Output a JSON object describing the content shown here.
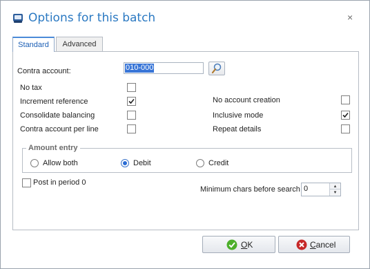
{
  "window": {
    "title": "Options for this batch",
    "close_glyph": "×",
    "icon": "batch-app-icon"
  },
  "tabs": [
    {
      "label": "Standard",
      "active": true
    },
    {
      "label": "Advanced",
      "active": false
    }
  ],
  "contra_account": {
    "label": "Contra account:",
    "value": "010-000",
    "search_icon": "magnifier-icon"
  },
  "left_options": [
    {
      "label": "No tax",
      "checked": false
    },
    {
      "label": "Increment reference",
      "checked": true
    },
    {
      "label": "Consolidate balancing",
      "checked": false
    },
    {
      "label": "Contra account per line",
      "checked": false
    }
  ],
  "right_options": [
    {
      "label": "No account creation",
      "checked": false
    },
    {
      "label": "Inclusive mode",
      "checked": true
    },
    {
      "label": "Repeat details",
      "checked": false
    }
  ],
  "amount_entry": {
    "label": "Amount entry",
    "options": [
      {
        "label": "Allow both",
        "selected": false
      },
      {
        "label": "Debit",
        "selected": true
      },
      {
        "label": "Credit",
        "selected": false
      }
    ]
  },
  "post_in_period": {
    "label": "Post in period 0",
    "checked": false
  },
  "min_chars": {
    "label": "Minimum chars before search",
    "value": "0",
    "up_glyph": "▴",
    "down_glyph": "▾"
  },
  "buttons": {
    "ok": {
      "label_prefix": "",
      "accel": "O",
      "label_suffix": "K",
      "icon": "green-check-icon"
    },
    "cancel": {
      "label_prefix": "",
      "accel": "C",
      "label_suffix": "ancel",
      "icon": "red-x-icon"
    }
  },
  "colors": {
    "title": "#2b79c2",
    "selection": "#3875d7",
    "check": "#222222",
    "ok_icon": "#4caf2a",
    "cancel_icon": "#c62828"
  }
}
